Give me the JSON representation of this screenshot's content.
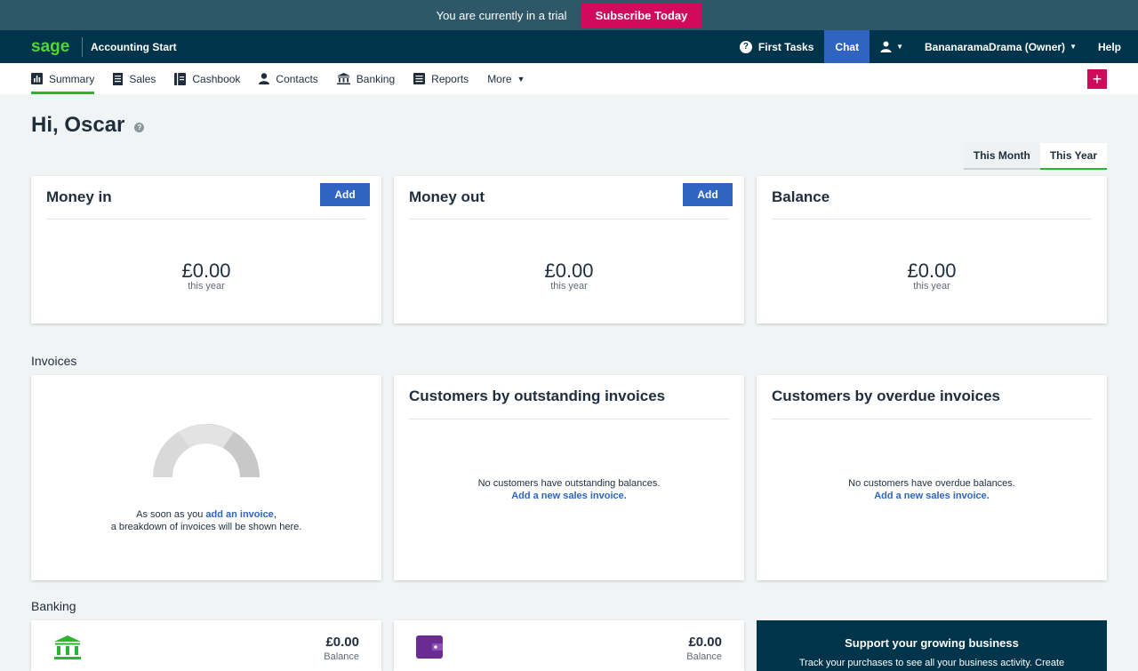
{
  "trial": {
    "message": "You are currently in a trial",
    "subscribe_label": "Subscribe Today"
  },
  "header": {
    "logo_text": "sage",
    "product": "Accounting Start",
    "first_tasks": "First Tasks",
    "chat": "Chat",
    "business": "BananaramaDrama (Owner)",
    "help": "Help"
  },
  "nav": {
    "tabs": [
      {
        "label": "Summary",
        "icon": "chart-icon"
      },
      {
        "label": "Sales",
        "icon": "receipt-icon"
      },
      {
        "label": "Cashbook",
        "icon": "book-icon"
      },
      {
        "label": "Contacts",
        "icon": "person-icon"
      },
      {
        "label": "Banking",
        "icon": "bank-icon"
      },
      {
        "label": "Reports",
        "icon": "report-icon"
      },
      {
        "label": "More",
        "icon": "caret-down-icon"
      }
    ],
    "plus": "+"
  },
  "greeting": "Hi, Oscar",
  "period": {
    "month": "This Month",
    "year": "This Year",
    "selected": "This Year"
  },
  "money_in": {
    "title": "Money in",
    "add": "Add",
    "amount": "£0.00",
    "sub": "this year"
  },
  "money_out": {
    "title": "Money out",
    "add": "Add",
    "amount": "£0.00",
    "sub": "this year"
  },
  "balance": {
    "title": "Balance",
    "amount": "£0.00",
    "sub": "this year"
  },
  "invoices": {
    "section": "Invoices",
    "breakdown_pre": "As soon as you ",
    "breakdown_link": "add an invoice",
    "breakdown_post": ",",
    "breakdown_line2": "a breakdown of invoices will be shown here.",
    "outstanding_title": "Customers by outstanding invoices",
    "outstanding_empty": "No customers have outstanding balances.",
    "outstanding_link": "Add a new sales invoice.",
    "overdue_title": "Customers by overdue invoices",
    "overdue_empty": "No customers have overdue balances.",
    "overdue_link": "Add a new sales invoice."
  },
  "banking": {
    "section": "Banking",
    "account1": {
      "amount": "£0.00",
      "sub": "Balance"
    },
    "account2": {
      "amount": "£0.00",
      "sub": "Balance"
    },
    "promo_title": "Support your growing business",
    "promo_text": "Track your purchases to see all your business activity. Create"
  },
  "colors": {
    "trial_bar": "#2e5767",
    "nav": "#00344a",
    "brand_pink": "#d10b5c",
    "accent_blue": "#2f64c2",
    "active_green": "#2bb530",
    "sage_green": "#4fd43a"
  }
}
